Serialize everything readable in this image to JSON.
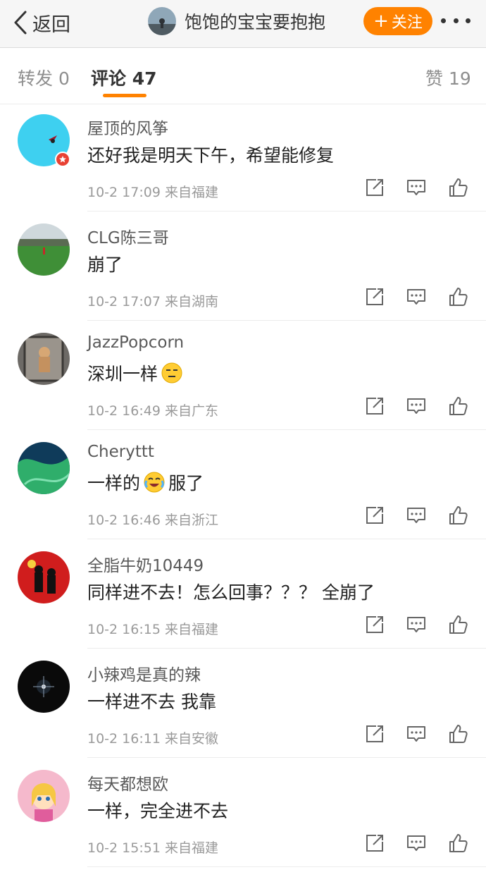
{
  "header": {
    "back_label": "返回",
    "title": "饱饱的宝宝要抱抱",
    "follow_plus": "+",
    "follow_label": "关注",
    "accent_color": "#ff8200"
  },
  "tabs": {
    "repost_label": "转发",
    "repost_count": "0",
    "comment_label": "评论",
    "comment_count": "47",
    "like_label": "赞",
    "like_count": "19"
  },
  "comments": [
    {
      "user": "屋顶的风筝",
      "text": "还好我是明天下午，希望能修复",
      "emoji": null,
      "text_after": "",
      "time": "10-2 17:09",
      "source": "来自福建",
      "verified": true
    },
    {
      "user": "CLG陈三哥",
      "text": "崩了",
      "emoji": null,
      "text_after": "",
      "time": "10-2 17:07",
      "source": "来自湖南",
      "verified": false
    },
    {
      "user": "JazzPopcorn",
      "text": "深圳一样",
      "emoji": "smirk-emoji",
      "text_after": "",
      "time": "10-2 16:49",
      "source": "来自广东",
      "verified": false
    },
    {
      "user": "Cheryttt",
      "text": "一样的",
      "emoji": "laugh-cry-emoji",
      "text_after": "服了",
      "time": "10-2 16:46",
      "source": "来自浙江",
      "verified": false
    },
    {
      "user": "全脂牛奶10449",
      "text": "同样进不去！怎么回事？？？ 全崩了",
      "emoji": null,
      "text_after": "",
      "time": "10-2 16:15",
      "source": "来自福建",
      "verified": false
    },
    {
      "user": "小辣鸡是真的辣",
      "text": "一样进不去 我靠",
      "emoji": null,
      "text_after": "",
      "time": "10-2 16:11",
      "source": "来自安徽",
      "verified": false
    },
    {
      "user": "每天都想欧",
      "text": "一样，完全进不去",
      "emoji": null,
      "text_after": "",
      "time": "10-2 15:51",
      "source": "来自福建",
      "verified": false
    }
  ],
  "icons": {
    "repost": "share-icon",
    "comment": "comment-icon",
    "like": "thumbs-up-icon"
  }
}
